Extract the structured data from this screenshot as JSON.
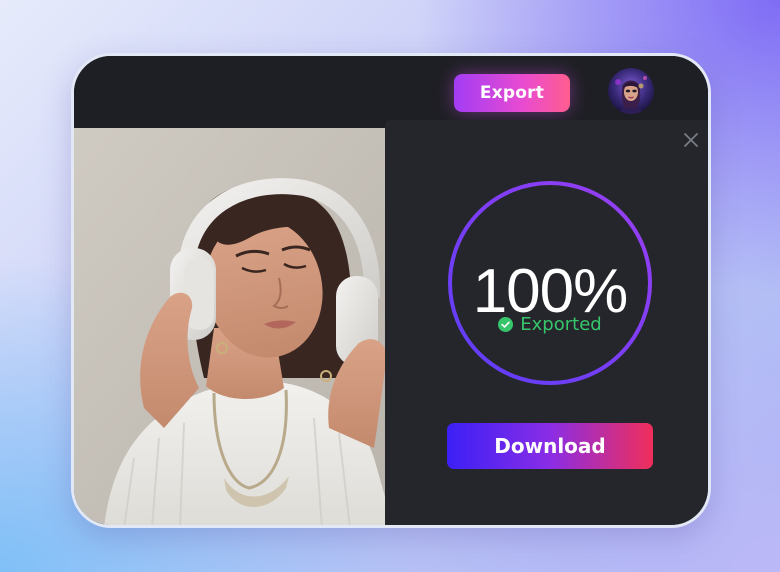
{
  "topbar": {
    "export_label": "Export",
    "avatar_icon": "user-avatar"
  },
  "panel": {
    "progress_percent": 100,
    "progress_label": "100%",
    "status_label": "Exported",
    "status_color": "#37c56c",
    "download_label": "Download",
    "close_icon": "close-icon"
  },
  "colors": {
    "export_gradient": [
      "#a23cf5",
      "#ff5d8f"
    ],
    "download_gradient": [
      "#3b20f5",
      "#f02e5a"
    ],
    "ring_gradient": [
      "#5b3df6",
      "#9b3ff5"
    ],
    "panel_bg": "#25262c",
    "topbar_bg": "#1e1f24"
  }
}
